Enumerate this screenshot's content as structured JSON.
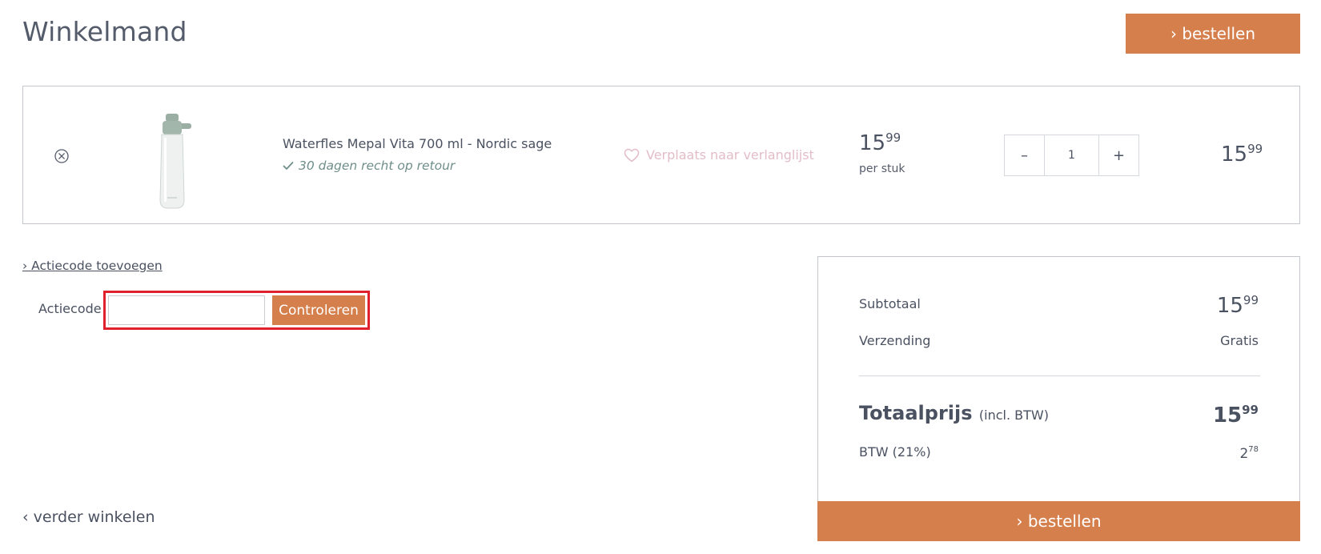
{
  "page": {
    "title": "Winkelmand",
    "order_button": "› bestellen"
  },
  "cart": {
    "items": [
      {
        "name": "Waterfles Mepal Vita 700 ml - Nordic sage",
        "return_note": "30 dagen recht op retour",
        "wishlist_label": "Verplaats naar verlanglijst",
        "unit_price_int": "15",
        "unit_price_dec": "99",
        "per_piece": "per stuk",
        "quantity": "1",
        "qty_minus": "–",
        "qty_plus": "+",
        "total_int": "15",
        "total_dec": "99"
      }
    ]
  },
  "promo": {
    "toggle": "› Actiecode toevoegen",
    "label": "Actiecode",
    "input_value": "",
    "check_button": "Controleren"
  },
  "continue": {
    "label": "‹ verder winkelen"
  },
  "summary": {
    "subtotal_label": "Subtotaal",
    "subtotal_int": "15",
    "subtotal_dec": "99",
    "shipping_label": "Verzending",
    "shipping_value": "Gratis",
    "total_label": "Totaalprijs",
    "total_incl": "(incl. BTW)",
    "total_int": "15",
    "total_dec": "99",
    "vat_label": "BTW (21%)",
    "vat_int": "2",
    "vat_dec": "78",
    "order_button": "› bestellen"
  },
  "icons": {
    "remove": "close-circle-icon",
    "check": "check-icon",
    "heart": "heart-outline-icon"
  },
  "colors": {
    "accent": "#d47f4c",
    "text": "#4a5160",
    "wishlist": "#e2bdc8",
    "return_note": "#6f8e8a",
    "highlight": "#e0202c"
  }
}
